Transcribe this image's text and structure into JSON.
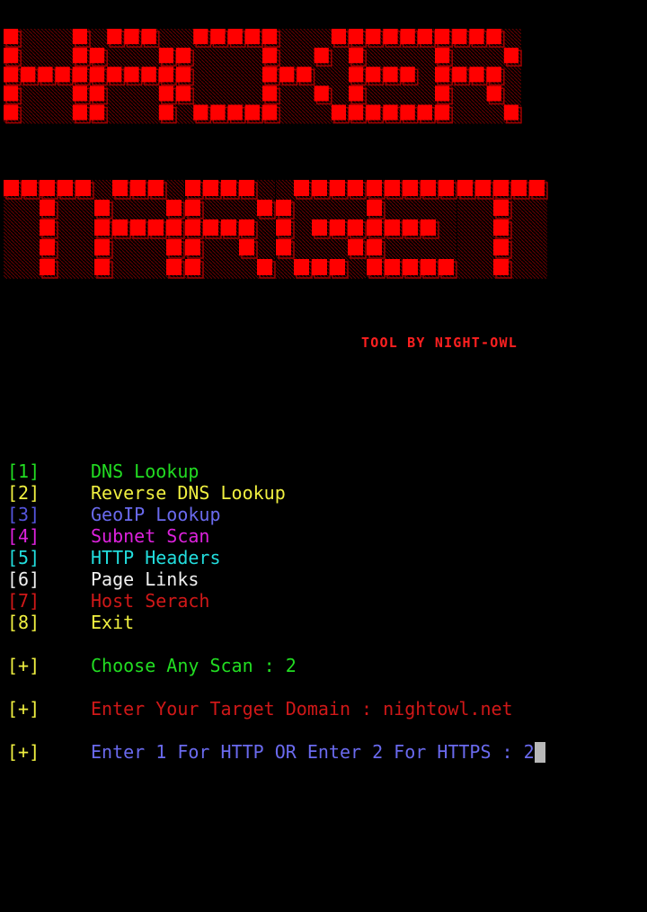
{
  "banner": {
    "line1": "HACKER",
    "line2": "TARGET",
    "credit": "TOOL BY NIGHT-OWL",
    "color": "#ff0000",
    "shadow_color": "#a00000"
  },
  "menu": [
    {
      "num": "[1]",
      "label": "DNS Lookup",
      "num_color": "#22dd22",
      "label_color": "#22dd22"
    },
    {
      "num": "[2]",
      "label": "Reverse DNS Lookup",
      "num_color": "#f0f040",
      "label_color": "#f0f040"
    },
    {
      "num": "[3]",
      "label": "GeoIP Lookup",
      "num_color": "#5555dd",
      "label_color": "#6a6aee"
    },
    {
      "num": "[4]",
      "label": "Subnet Scan",
      "num_color": "#dd22dd",
      "label_color": "#dd22dd"
    },
    {
      "num": "[5]",
      "label": "HTTP Headers",
      "num_color": "#22dddd",
      "label_color": "#22dddd"
    },
    {
      "num": "[6]",
      "label": "Page Links",
      "num_color": "#f0f0f0",
      "label_color": "#f0f0f0"
    },
    {
      "num": "[7]",
      "label": "Host Serach",
      "num_color": "#d01818",
      "label_color": "#d01818"
    },
    {
      "num": "[8]",
      "label": "Exit",
      "num_color": "#f0f040",
      "label_color": "#f0f040"
    }
  ],
  "prompts": [
    {
      "marker": "[+]",
      "text": "Choose Any Scan : 2",
      "marker_color": "#f0f040",
      "text_color": "#22dd22"
    },
    {
      "marker": "[+]",
      "text": "Enter Your Target Domain : nightowl.net",
      "marker_color": "#f0f040",
      "text_color": "#d01818"
    },
    {
      "marker": "[+]",
      "text": "Enter 1 For HTTP OR Enter 2 For HTTPS : 2",
      "marker_color": "#f0f040",
      "text_color": "#6a6aee"
    }
  ],
  "cursor_color": "#b8b8b8"
}
